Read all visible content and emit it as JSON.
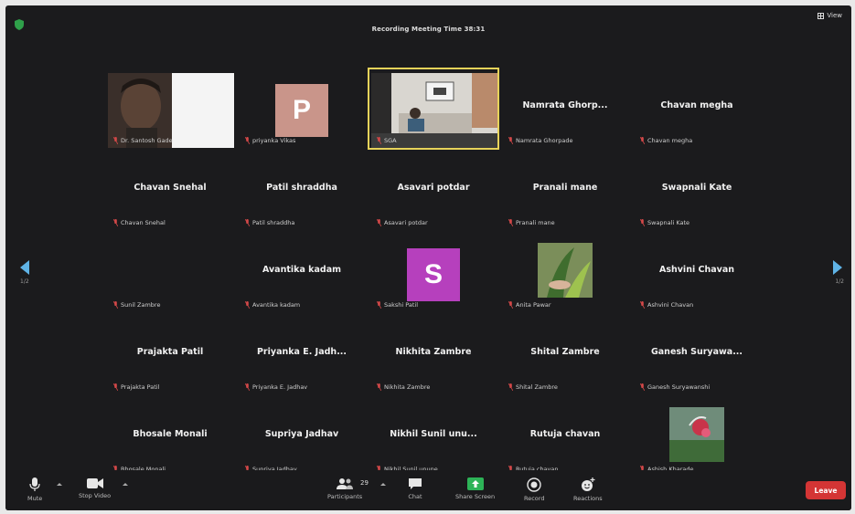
{
  "meeting": {
    "title": "Recording Meeting Time 38:31",
    "view_label": "View",
    "page_left": "1/2",
    "page_right": "1/2"
  },
  "colors": {
    "active_border": "#e7d35a",
    "avatar_p": "#c9958a",
    "avatar_s": "#b640bd",
    "end_button": "#d43535",
    "share_screen": "#2db357",
    "mute_icon": "#d34848"
  },
  "participants": [
    {
      "display_name": "",
      "label": "Dr. Santosh Gade",
      "kind": "video-face"
    },
    {
      "display_name": "",
      "label": "priyanka Vikas",
      "kind": "avatar",
      "letter": "P",
      "color": "#c9958a"
    },
    {
      "display_name": "",
      "label": "SGA",
      "kind": "video-room",
      "active": true
    },
    {
      "display_name": "Namrata Ghorp...",
      "label": "Namrata Ghorpade",
      "kind": "name"
    },
    {
      "display_name": "Chavan megha",
      "label": "Chavan megha",
      "kind": "name"
    },
    {
      "display_name": "Chavan Snehal",
      "label": "Chavan Snehal",
      "kind": "name"
    },
    {
      "display_name": "Patil shraddha",
      "label": "Patil shraddha",
      "kind": "name"
    },
    {
      "display_name": "Asavari potdar",
      "label": "Asavari potdar",
      "kind": "name"
    },
    {
      "display_name": "Pranali mane",
      "label": "Pranali mane",
      "kind": "name"
    },
    {
      "display_name": "Swapnali Kate",
      "label": "Swapnali Kate",
      "kind": "name"
    },
    {
      "display_name": "",
      "label": "Sunil Zambre",
      "kind": "blank"
    },
    {
      "display_name": "Avantika kadam",
      "label": "Avantika kadam",
      "kind": "name"
    },
    {
      "display_name": "",
      "label": "Sakshi Patil",
      "kind": "avatar",
      "letter": "S",
      "color": "#b640bd"
    },
    {
      "display_name": "",
      "label": "Anita Pawar",
      "kind": "photo-plant"
    },
    {
      "display_name": "Ashvini Chavan",
      "label": "Ashvini Chavan",
      "kind": "name"
    },
    {
      "display_name": "Prajakta Patil",
      "label": "Prajakta Patil",
      "kind": "name"
    },
    {
      "display_name": "Priyanka E. Jadh...",
      "label": "Priyanka E. Jadhav",
      "kind": "name"
    },
    {
      "display_name": "Nikhita Zambre",
      "label": "Nikhita Zambre",
      "kind": "name"
    },
    {
      "display_name": "Shital Zambre",
      "label": "Shital Zambre",
      "kind": "name"
    },
    {
      "display_name": "Ganesh Suryawa...",
      "label": "Ganesh Suryawanshi",
      "kind": "name"
    },
    {
      "display_name": "Bhosale Monali",
      "label": "Bhosale Monali",
      "kind": "name"
    },
    {
      "display_name": "Supriya Jadhav",
      "label": "Supriya Jadhav",
      "kind": "name"
    },
    {
      "display_name": "Nikhil Sunil unu...",
      "label": "Nikhil Sunil unune",
      "kind": "name"
    },
    {
      "display_name": "Rutuja chavan",
      "label": "Rutuja chavan",
      "kind": "name"
    },
    {
      "display_name": "",
      "label": "Ashish Kharade",
      "kind": "photo-flower"
    }
  ],
  "toolbar": {
    "mute": "Mute",
    "stop_video": "Stop Video",
    "participants": "Participants",
    "participant_count": "29",
    "chat": "Chat",
    "share_screen": "Share Screen",
    "record": "Record",
    "reactions": "Reactions",
    "end": "Leave"
  }
}
